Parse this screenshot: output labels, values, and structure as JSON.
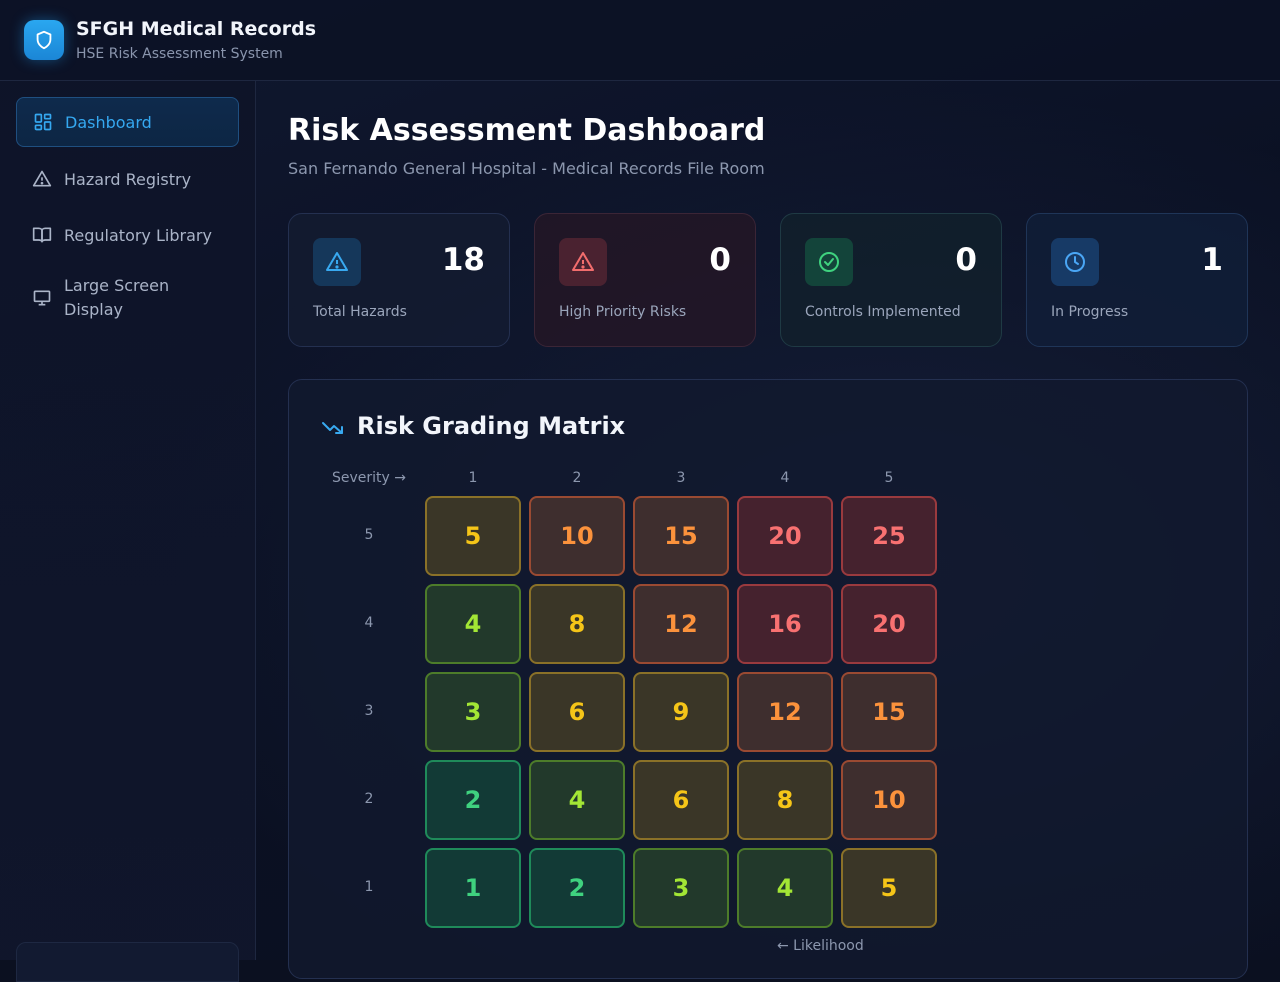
{
  "header": {
    "title": "SFGH Medical Records",
    "subtitle": "HSE Risk Assessment System",
    "logo_icon": "shield-icon"
  },
  "sidebar": {
    "items": [
      {
        "label": "Dashboard",
        "icon": "dashboard-grid-icon",
        "active": true
      },
      {
        "label": "Hazard Registry",
        "icon": "warning-triangle-icon",
        "active": false
      },
      {
        "label": "Regulatory Library",
        "icon": "book-icon",
        "active": false
      },
      {
        "label": "Large Screen Display",
        "icon": "monitor-icon",
        "active": false
      }
    ]
  },
  "main": {
    "title": "Risk Assessment Dashboard",
    "subtitle": "San Fernando General Hospital - Medical Records File Room"
  },
  "stats": [
    {
      "value": "18",
      "label": "Total Hazards",
      "icon": "warning-triangle-icon",
      "color": "#38a9f0"
    },
    {
      "value": "0",
      "label": "High Priority Risks",
      "icon": "alert-triangle-icon",
      "color": "#f26d6d"
    },
    {
      "value": "0",
      "label": "Controls Implemented",
      "icon": "check-circle-icon",
      "color": "#3fd27f"
    },
    {
      "value": "1",
      "label": "In Progress",
      "icon": "clock-icon",
      "color": "#4aa6f5"
    }
  ],
  "matrix": {
    "title": "Risk Grading Matrix",
    "icon": "trending-down-icon",
    "severity_label": "Severity →",
    "likelihood_label": "← Likelihood",
    "columns": [
      "1",
      "2",
      "3",
      "4",
      "5"
    ],
    "rows": [
      {
        "label": "5",
        "cells": [
          "5",
          "10",
          "15",
          "20",
          "25"
        ]
      },
      {
        "label": "4",
        "cells": [
          "4",
          "8",
          "12",
          "16",
          "20"
        ]
      },
      {
        "label": "3",
        "cells": [
          "3",
          "6",
          "9",
          "12",
          "15"
        ]
      },
      {
        "label": "2",
        "cells": [
          "2",
          "4",
          "6",
          "8",
          "10"
        ]
      },
      {
        "label": "1",
        "cells": [
          "1",
          "2",
          "3",
          "4",
          "5"
        ]
      }
    ],
    "colors": {
      "green": {
        "text": "#3fd27f",
        "border": "#1f8a5a",
        "bg": "#123a36"
      },
      "lime": {
        "text": "#a3e635",
        "border": "#4d7c2a",
        "bg": "#22392b"
      },
      "yellow": {
        "text": "#f5c518",
        "border": "#8a7128",
        "bg": "#3a3627"
      },
      "orange": {
        "text": "#fb923c",
        "border": "#9a4a32",
        "bg": "#3e2e2e"
      },
      "red": {
        "text": "#f87171",
        "border": "#9a3a3e",
        "bg": "#45222e"
      }
    }
  }
}
